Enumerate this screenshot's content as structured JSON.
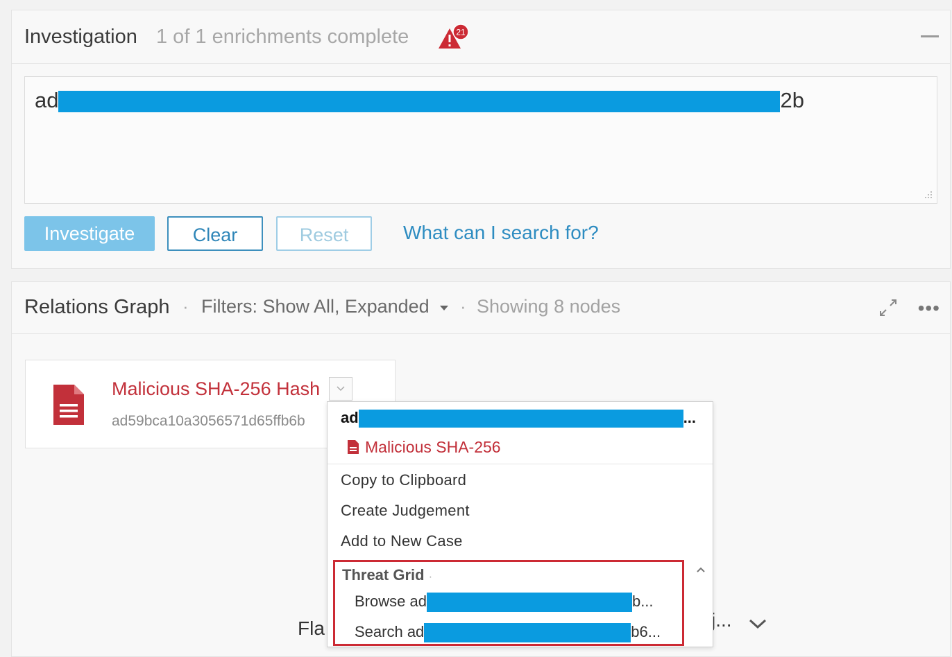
{
  "investigation": {
    "title": "Investigation",
    "status": "1 of 1 enrichments complete",
    "alert_count": "21",
    "query_prefix": "ad",
    "query_suffix": "2b",
    "buttons": {
      "investigate": "Investigate",
      "clear": "Clear",
      "reset": "Reset"
    },
    "help_link": "What can I search for?"
  },
  "relations": {
    "title": "Relations Graph",
    "separator": "·",
    "filters": "Filters: Show All, Expanded",
    "showing": "Showing 8 nodes",
    "more": "•••"
  },
  "node": {
    "title": "Malicious SHA-256 Hash",
    "hash": "ad59bca10a3056571d65ffb6b",
    "below_left": "Fla",
    "below_right": "j..."
  },
  "menu": {
    "hash_prefix": "ad",
    "hash_suffix": "...",
    "type": "Malicious SHA-256",
    "items": [
      "Copy to Clipboard",
      "Create Judgement",
      "Add to New Case"
    ],
    "section_title": "Threat Grid",
    "section_mark": "·",
    "browse_prefix": "Browse ad",
    "browse_suffix": "b...",
    "search_prefix": "Search ad",
    "search_suffix": "b6..."
  },
  "colors": {
    "malicious": "#c2303a",
    "accent": "#2d8cc1",
    "redaction": "#0a9be0",
    "highlight_border": "#cc2a34"
  },
  "icons": [
    "alert-icon",
    "file-icon",
    "expand-icon",
    "more-icon",
    "chevron-down-icon",
    "chevron-up-icon",
    "resize-handle-icon",
    "collapse-icon"
  ]
}
